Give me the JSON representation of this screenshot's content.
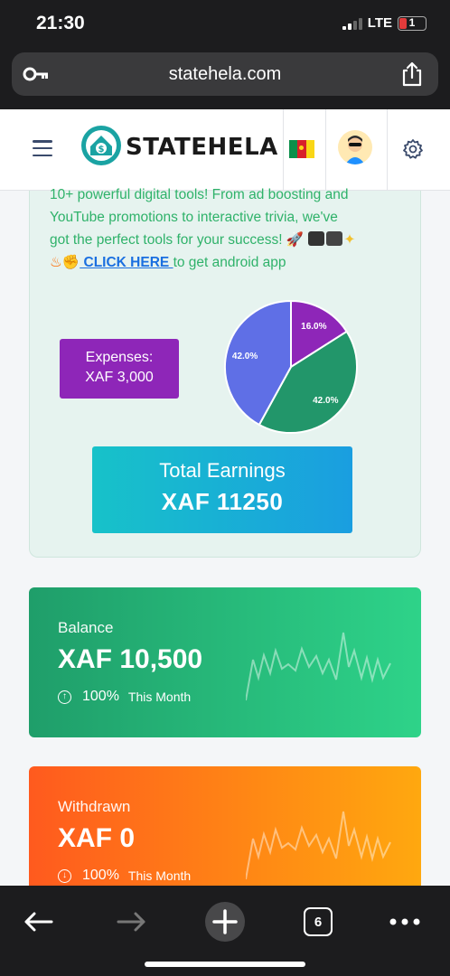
{
  "status_bar": {
    "time": "21:30",
    "network": "LTE",
    "battery_level": "1"
  },
  "browser": {
    "url": "statehela.com",
    "tabs_count": "6"
  },
  "site_header": {
    "brand": "STATEHELA"
  },
  "promo": {
    "line1": "10+ powerful digital tools! From ad boosting and",
    "line2": "YouTube promotions to interactive trivia, we've",
    "line3": "got the perfect tools for your success! 🚀",
    "link_text": " CLICK HERE ",
    "after_link": "to get android app"
  },
  "expenses": {
    "label": "Expenses:",
    "value": "XAF 3,000"
  },
  "chart_data": {
    "type": "pie",
    "slices": [
      {
        "label": "16.0%",
        "value": 16.0,
        "color": "#8e26b8"
      },
      {
        "label": "42.0%",
        "value": 42.0,
        "color": "#22966a"
      },
      {
        "label": "42.0%",
        "value": 42.0,
        "color": "#5f6fe6"
      }
    ],
    "visible_labels": [
      "16.0%",
      "42.0%",
      "42.0%"
    ]
  },
  "earnings": {
    "title": "Total Earnings",
    "value": "XAF 11250"
  },
  "balance": {
    "label": "Balance",
    "value": "XAF 10,500",
    "percent": "100%",
    "period": "This Month"
  },
  "withdrawn": {
    "label": "Withdrawn",
    "value": "XAF 0",
    "percent": "100%",
    "period": "This Month"
  },
  "colors": {
    "brand_teal": "#1aa3a3",
    "promo_green": "#2fb26a",
    "link_blue": "#1a6fe0"
  }
}
